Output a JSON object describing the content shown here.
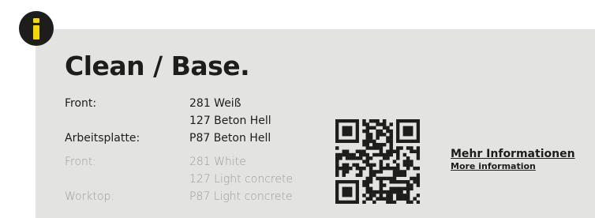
{
  "info_icon": {
    "icon": "info-icon",
    "color": "#f5d800",
    "background": "#1d1d1b"
  },
  "panel": {
    "background": "#e3e3e2"
  },
  "title": "Clean / Base.",
  "specs_de": [
    {
      "label": "Front:",
      "value_line1": "281 Weiß",
      "value_line2": "127 Beton Hell"
    },
    {
      "label": "Arbeitsplatte:",
      "value_line1": "P87 Beton Hell"
    }
  ],
  "specs_en": [
    {
      "label": "Front:",
      "value_line1": "281 White",
      "value_line2": "127 Light concrete"
    },
    {
      "label": "Worktop:",
      "value_line1": "P87 Light concrete"
    }
  ],
  "qr_code": {
    "icon": "qr-code"
  },
  "more_link": {
    "label_de": "Mehr Informationen",
    "label_en": "More information"
  }
}
